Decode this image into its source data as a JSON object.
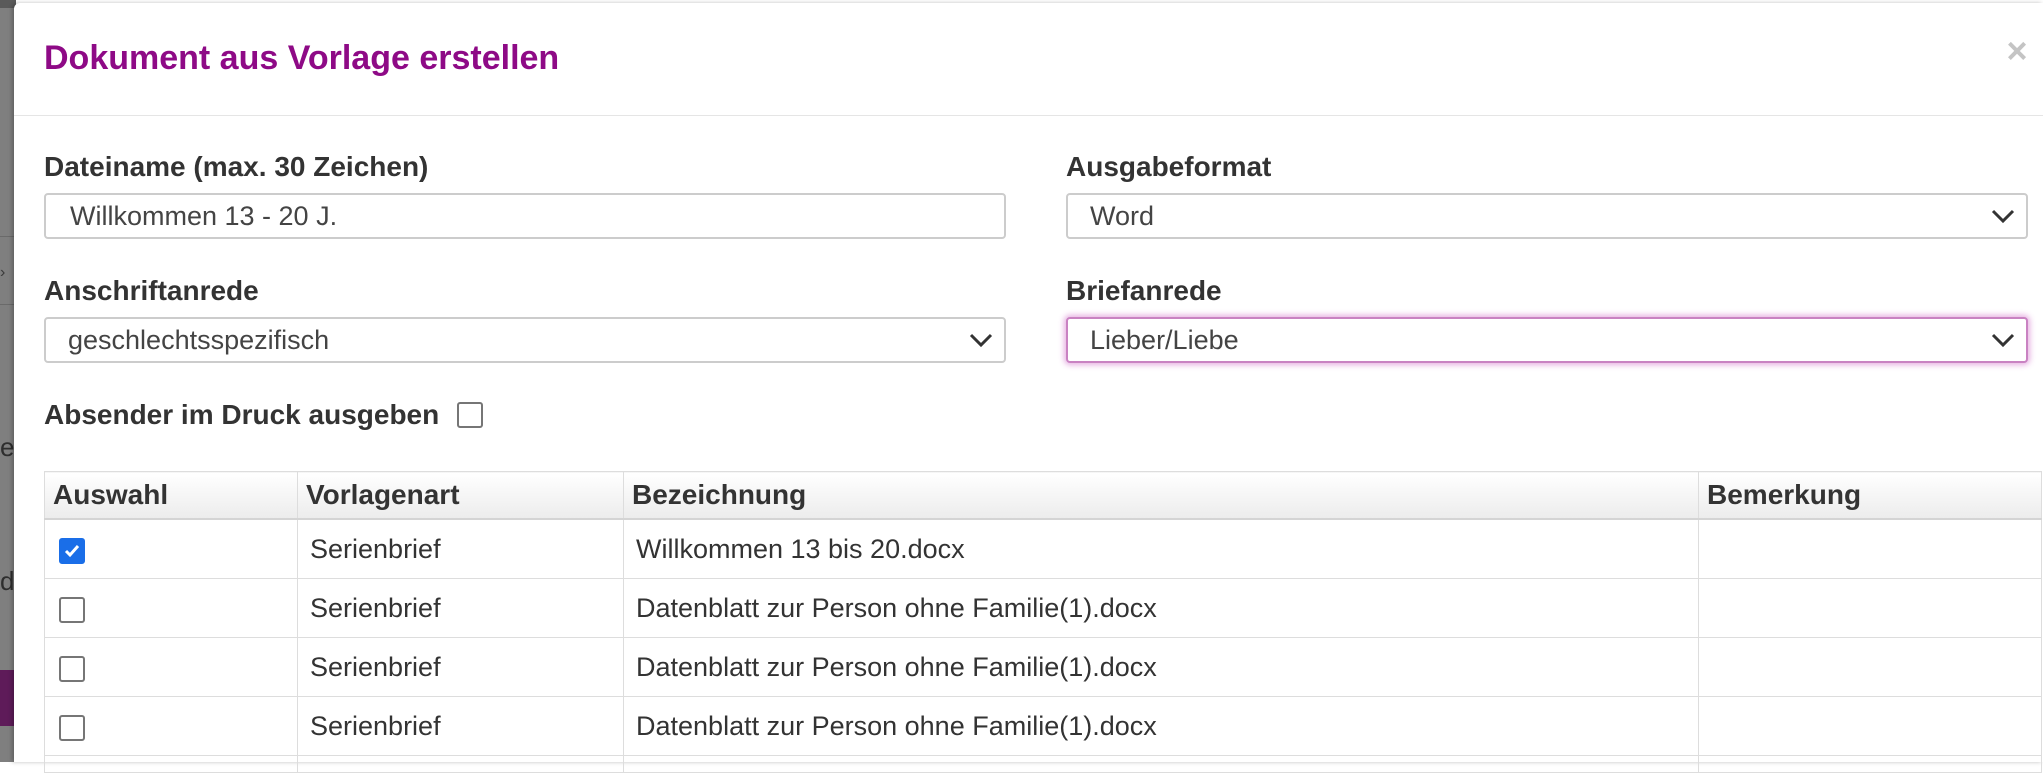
{
  "dialog": {
    "title": "Dokument aus Vorlage erstellen",
    "close_glyph": "×"
  },
  "form": {
    "filename": {
      "label": "Dateiname (max. 30 Zeichen)",
      "value": "Willkommen 13 - 20 J."
    },
    "output_format": {
      "label": "Ausgabeformat",
      "selected": "Word"
    },
    "address_salutation": {
      "label": "Anschriftanrede",
      "selected": "geschlechtsspezifisch"
    },
    "letter_salutation": {
      "label": "Briefanrede",
      "selected": "Lieber/Liebe",
      "focused": true
    },
    "sender_print": {
      "label": "Absender im Druck ausgeben",
      "checked": false
    }
  },
  "table": {
    "headers": [
      "Auswahl",
      "Vorlagenart",
      "Bezeichnung",
      "Bemerkung"
    ],
    "rows": [
      {
        "checked": true,
        "type": "Serienbrief",
        "name": "Willkommen 13 bis 20.docx",
        "remark": ""
      },
      {
        "checked": false,
        "type": "Serienbrief",
        "name": "Datenblatt zur Person ohne Familie(1).docx",
        "remark": ""
      },
      {
        "checked": false,
        "type": "Serienbrief",
        "name": "Datenblatt zur Person ohne Familie(1).docx",
        "remark": ""
      },
      {
        "checked": false,
        "type": "Serienbrief",
        "name": "Datenblatt zur Person ohne Familie(1).docx",
        "remark": ""
      }
    ]
  },
  "background": {
    "partial_chars": [
      "e",
      "de"
    ]
  },
  "colors": {
    "title": "#8e0a86",
    "checkbox_checked": "#1a6ee8",
    "focus_ring": "#c982c2",
    "backdrop": "#7f7f7f",
    "backdrop_accent": "#5e1b59"
  },
  "icons": {
    "close": "close-icon",
    "select_arrow": "chevron-down-icon",
    "checkmark": "checkmark-icon"
  }
}
